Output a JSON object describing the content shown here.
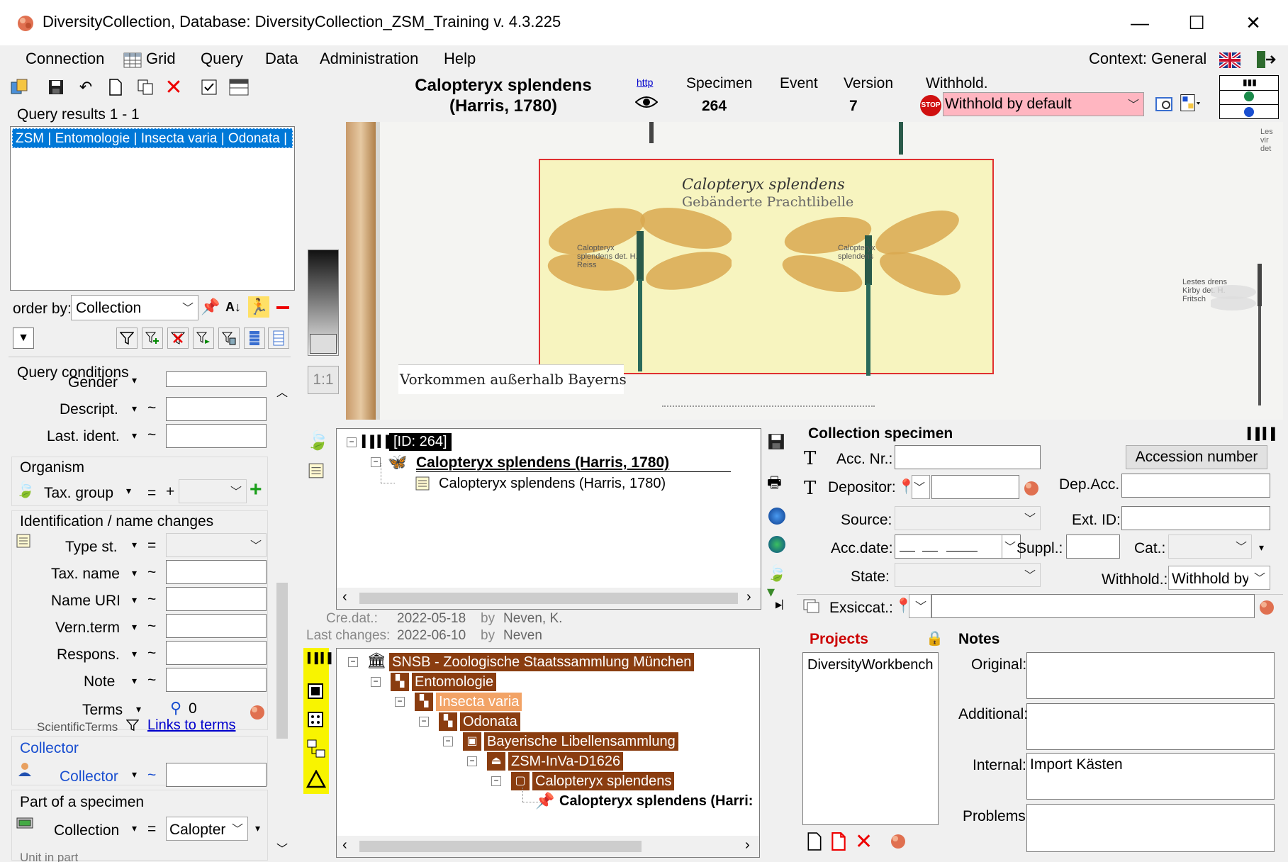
{
  "window": {
    "title": "DiversityCollection,  Database: DiversityCollection_ZSM_Training    v. 4.3.225",
    "minimize": "—",
    "maximize": "☐",
    "close": "✕"
  },
  "menu": {
    "connection": "Connection",
    "grid": "Grid",
    "query": "Query",
    "data": "Data",
    "administration": "Administration",
    "help": "Help",
    "context": "Context: General"
  },
  "header": {
    "taxon_line1": "Calopteryx splendens",
    "taxon_line2": "(Harris, 1780)",
    "http_label": "http",
    "specimen_label": "Specimen",
    "specimen_value": "264",
    "event_label": "Event",
    "version_label": "Version",
    "version_value": "7",
    "withhold_label": "Withhold.",
    "withhold_value": "Withhold by default",
    "stop_icon_text": "STOP"
  },
  "query": {
    "results_label": "Query results   1 - 1",
    "results": [
      "ZSM | Entomologie | Insecta varia | Odonata | B"
    ],
    "order_by_label": "order by:",
    "order_by_value": "Collection",
    "conditions_title": "Query conditions",
    "gender_label": "Gender",
    "descript_label": "Descript.",
    "last_ident_label": "Last. ident.",
    "organism_title": "Organism",
    "tax_group_label": "Tax. group",
    "identification_title": "Identification / name changes",
    "type_st_label": "Type st.",
    "tax_name_label": "Tax. name",
    "name_uri_label": "Name URI",
    "vern_term_label": "Vern.term",
    "respons_label": "Respons.",
    "note_label": "Note",
    "terms_label": "Terms",
    "terms_count": "0",
    "scientific_terms_label": "ScientificTerms",
    "links_to_terms": "Links to terms",
    "collector_title": "Collector",
    "collector_label": "Collector",
    "part_title": "Part of a specimen",
    "collection_label": "Collection",
    "collection_value": "Calopter",
    "unit_in_part": "Unit in part",
    "op_eq": "=",
    "op_tilde": "~",
    "op_plus": "+"
  },
  "image_viewer": {
    "one_to_one": "1:1",
    "label_title": "Calopteryx splendens",
    "label_subtitle": "Gebänderte Prachtlibelle",
    "bottom_label": "Vorkommen außerhalb Bayerns",
    "pin_label_left": "Calopteryx splendens det. H. Reiss",
    "pin_label_right": "Calopteryx splendens",
    "edge_label": "Lestes drens Kirby det. H. Fritsch",
    "top_right_label": "Les vir det"
  },
  "tree_top": {
    "id_node": "[ID: 264]",
    "taxon_bold": "Calopteryx splendens (Harris, 1780)",
    "taxon_child": "Calopteryx splendens (Harris, 1780)"
  },
  "audit": {
    "cre_label": "Cre.dat.:",
    "cre_date": "2022-05-18",
    "cre_by": "by",
    "cre_user": "Neven, K.",
    "last_label": "Last changes:",
    "last_date": "2022-06-10",
    "last_by": "by",
    "last_user": "Neven"
  },
  "tree_bottom": {
    "nodes": [
      "SNSB - Zoologische Staatssammlung München",
      "Entomologie",
      "Insecta varia",
      "Odonata",
      "Bayerische Libellensammlung",
      "ZSM-InVa-D1626",
      "Calopteryx splendens",
      "Calopteryx splendens (Harri:"
    ]
  },
  "specimen": {
    "title": "Collection specimen",
    "acc_nr_label": "Acc. Nr.:",
    "accession_button": "Accession number",
    "depositor_label": "Depositor:",
    "dep_acc_label": "Dep.Acc.",
    "source_label": "Source:",
    "ext_id_label": "Ext. ID:",
    "acc_date_label": "Acc.date:",
    "suppl_label": "Suppl.:",
    "cat_label": "Cat.:",
    "state_label": "State:",
    "withhold_label": "Withhold.:",
    "withhold_value": "Withhold by d",
    "exsiccat_label": "Exsiccat.:",
    "projects_title": "Projects",
    "projects": [
      "DiversityWorkbench"
    ],
    "notes_title": "Notes",
    "original_label": "Original:",
    "additional_label": "Additional:",
    "internal_label": "Internal:",
    "internal_value": "Import Kästen",
    "problems_label": "Problems:"
  },
  "colors": {
    "tree_dark": "#8a3d10",
    "tree_light": "#f2a366",
    "selection": "#0078d7",
    "withhold_bg": "#ffb6c1",
    "projects_title": "#cc0000",
    "link": "#0000cc"
  }
}
